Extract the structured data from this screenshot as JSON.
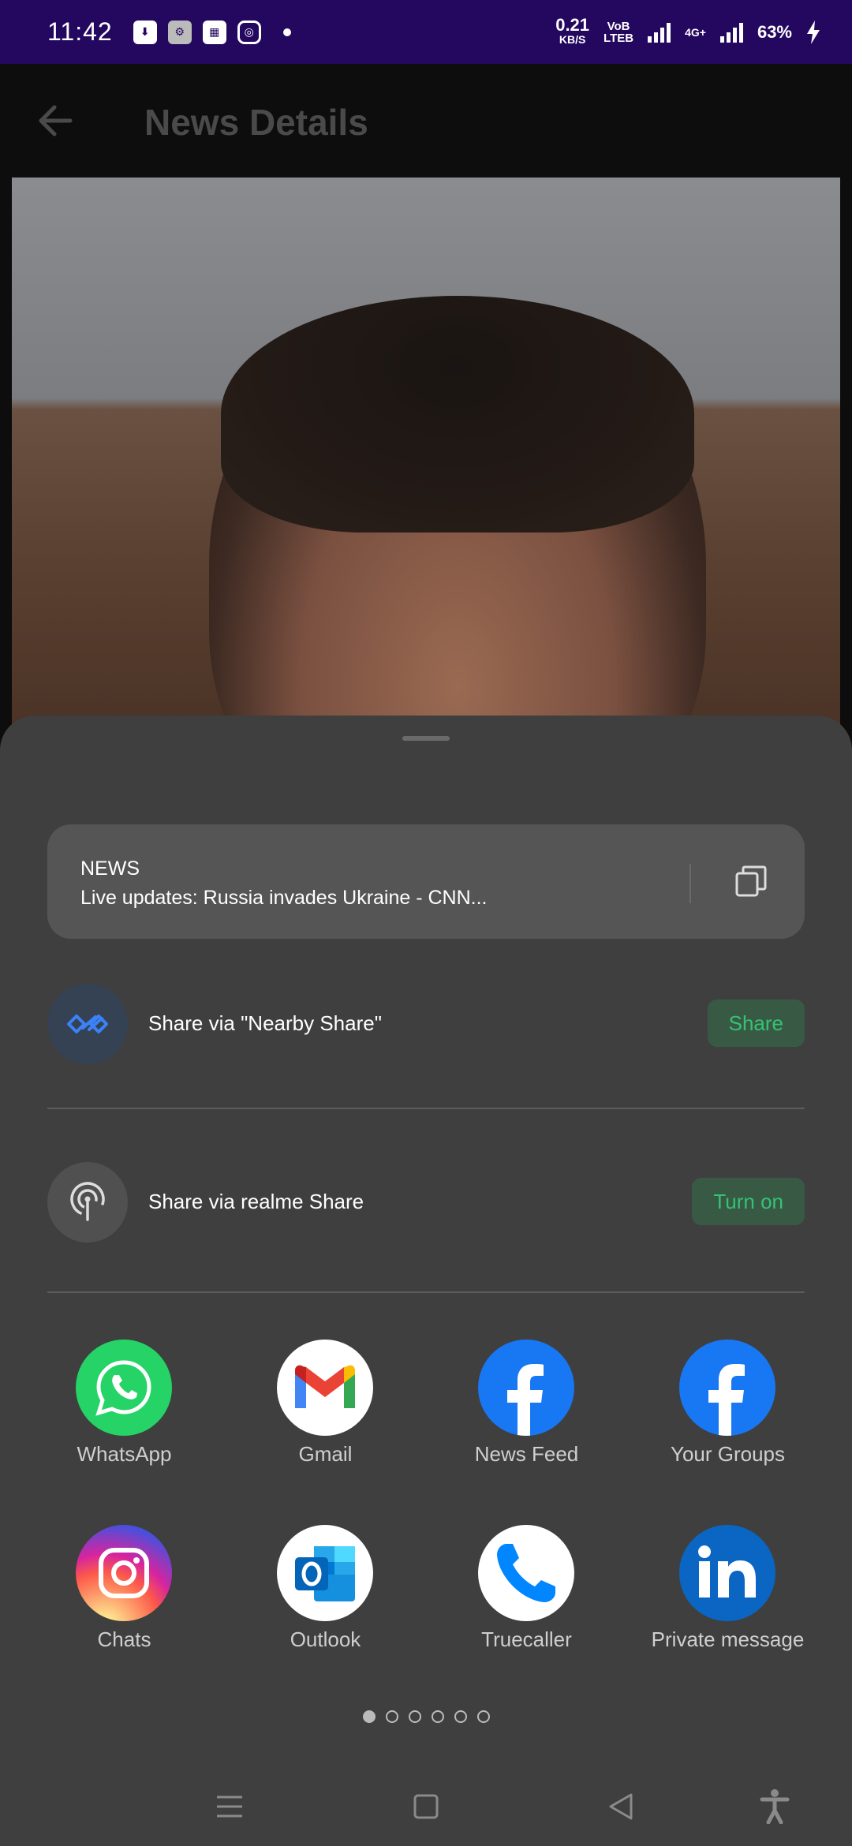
{
  "status_bar": {
    "time": "11:42",
    "speed_value": "0.21",
    "speed_unit": "KB/S",
    "volte_top": "VoB",
    "volte_bottom": "LTEB",
    "network": "4G+",
    "battery": "63%"
  },
  "app_bar": {
    "title": "News Details"
  },
  "share_sheet": {
    "preview": {
      "title": "NEWS",
      "subtitle": "Live updates: Russia invades Ukraine - CNN..."
    },
    "nearby": {
      "label": "Share via \"Nearby Share\"",
      "button": "Share"
    },
    "realme": {
      "label": "Share via realme Share",
      "button": "Turn on"
    },
    "apps": [
      {
        "label": "WhatsApp",
        "icon": "whatsapp-icon"
      },
      {
        "label": "Gmail",
        "icon": "gmail-icon"
      },
      {
        "label": "News Feed",
        "icon": "facebook-icon"
      },
      {
        "label": "Your Groups",
        "icon": "facebook-icon"
      },
      {
        "label": "Chats",
        "icon": "instagram-icon"
      },
      {
        "label": "Outlook",
        "icon": "outlook-icon"
      },
      {
        "label": "Truecaller",
        "icon": "truecaller-icon"
      },
      {
        "label": "Private message",
        "icon": "linkedin-icon"
      }
    ],
    "pager": {
      "pages": 6,
      "current": 1
    }
  },
  "colors": {
    "status_bar": "#24075e",
    "sheet": "#3f3f3f",
    "accent_green": "#35c274"
  }
}
